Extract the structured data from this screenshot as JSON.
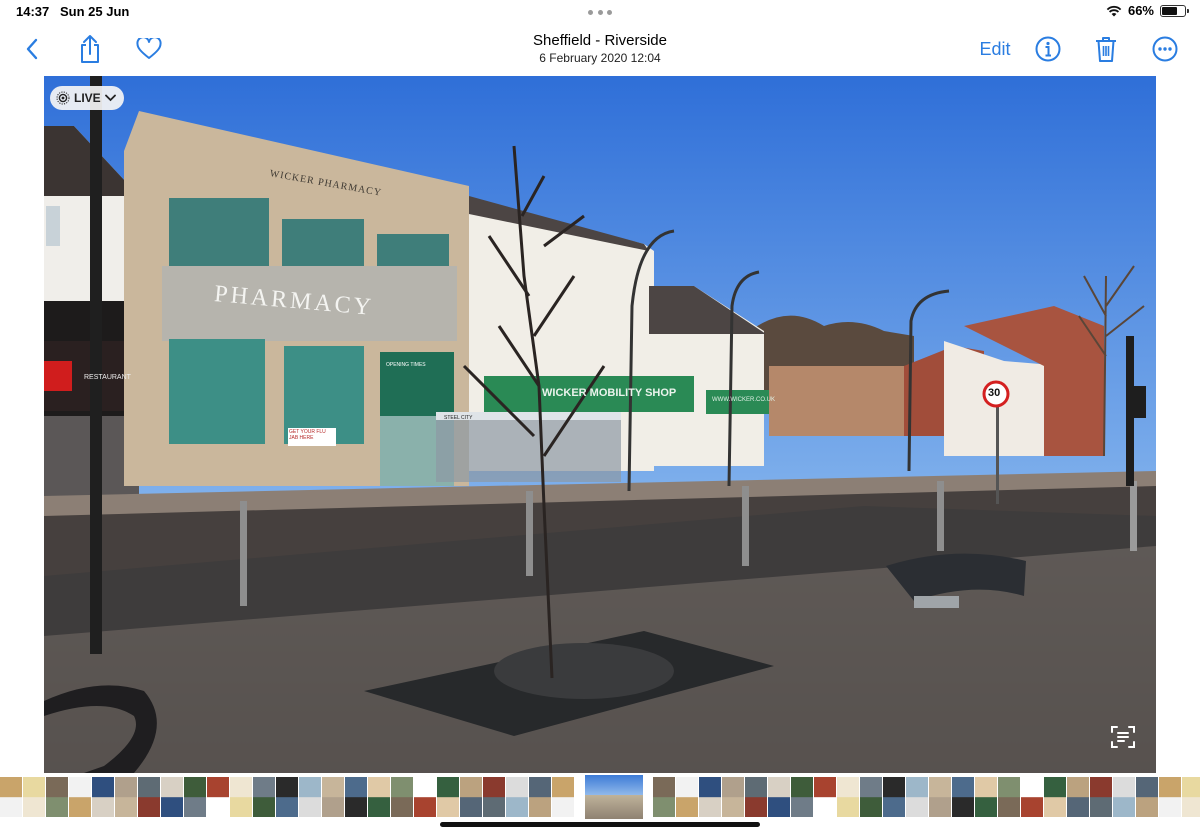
{
  "status_bar": {
    "time": "14:37",
    "date": "Sun 25 Jun",
    "battery_percent": "66%",
    "battery_level": 0.66,
    "wifi_icon": "wifi-icon"
  },
  "nav": {
    "title": "Sheffield - Riverside",
    "subtitle": "6 February 2020  12:04",
    "edit_label": "Edit",
    "accent_color": "#2a7de1",
    "icons": [
      "back-chevron-icon",
      "share-icon",
      "heart-icon",
      "info-icon",
      "trash-icon",
      "more-icon"
    ]
  },
  "photo": {
    "live_label": "LIVE",
    "signage": {
      "building": "WICKER PHARMACY",
      "pharmacy": "PHARMACY",
      "shop": "WICKER MOBILITY SHOP",
      "hours": "OPENING TIMES",
      "speed": "30",
      "flu": "GET YOUR FLU JAB HERE",
      "restaurant": "RESTAURANT",
      "web": "WWW.WICKER.CO.UK",
      "steel": "STEEL CITY"
    }
  },
  "filmstrip": {
    "thumb_count": 52,
    "selected_index": 25
  }
}
